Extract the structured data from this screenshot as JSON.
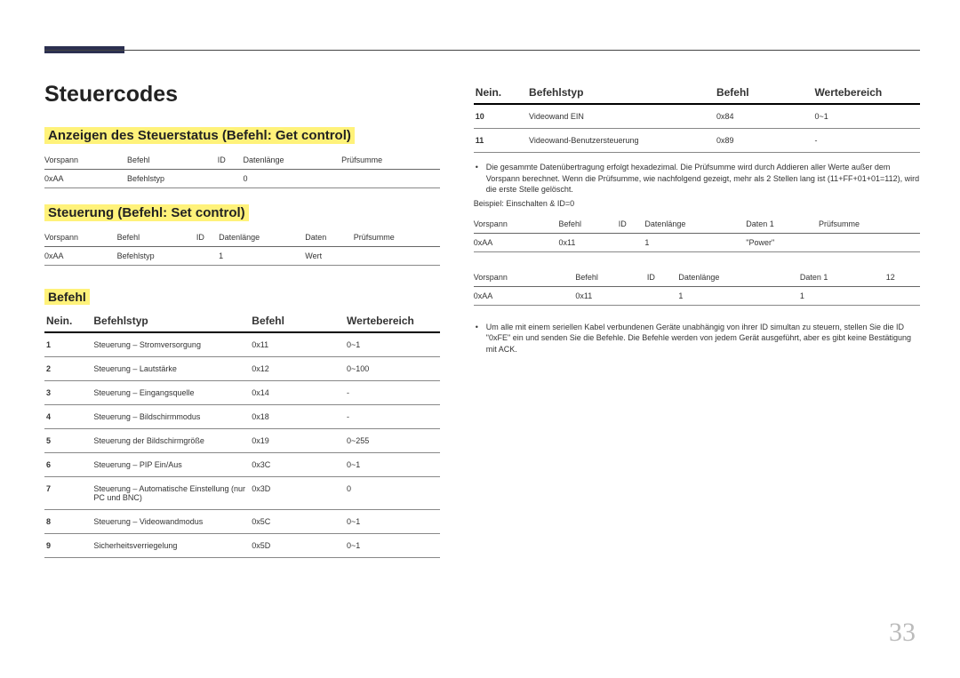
{
  "page_number": "33",
  "title": "Steuercodes",
  "section1": {
    "heading": "Anzeigen des Steuerstatus (Befehl: Get control)",
    "headers": [
      "Vorspann",
      "Befehl",
      "ID",
      "Datenlänge",
      "Prüfsumme"
    ],
    "row": [
      "0xAA",
      "Befehlstyp",
      "",
      "0",
      ""
    ]
  },
  "section2": {
    "heading": "Steuerung (Befehl: Set control)",
    "headers": [
      "Vorspann",
      "Befehl",
      "ID",
      "Datenlänge",
      "Daten",
      "Prüfsumme"
    ],
    "row": [
      "0xAA",
      "Befehlstyp",
      "",
      "1",
      "Wert",
      ""
    ]
  },
  "befehl_heading": "Befehl",
  "cmd_headers": {
    "no": "Nein.",
    "type": "Befehlstyp",
    "cmd": "Befehl",
    "range": "Wertebereich"
  },
  "cmd_rows_left": [
    {
      "no": "1",
      "type": "Steuerung – Stromversorgung",
      "cmd": "0x11",
      "range": "0~1"
    },
    {
      "no": "2",
      "type": "Steuerung – Lautstärke",
      "cmd": "0x12",
      "range": "0~100"
    },
    {
      "no": "3",
      "type": "Steuerung – Eingangsquelle",
      "cmd": "0x14",
      "range": "-"
    },
    {
      "no": "4",
      "type": "Steuerung – Bildschirmmodus",
      "cmd": "0x18",
      "range": "-"
    },
    {
      "no": "5",
      "type": "Steuerung der Bildschirmgröße",
      "cmd": "0x19",
      "range": "0~255"
    },
    {
      "no": "6",
      "type": "Steuerung – PIP Ein/Aus",
      "cmd": "0x3C",
      "range": "0~1"
    },
    {
      "no": "7",
      "type": "Steuerung – Automatische Einstellung (nur PC und BNC)",
      "cmd": "0x3D",
      "range": "0"
    },
    {
      "no": "8",
      "type": "Steuerung – Videowandmodus",
      "cmd": "0x5C",
      "range": "0~1"
    },
    {
      "no": "9",
      "type": "Sicherheitsverriegelung",
      "cmd": "0x5D",
      "range": "0~1"
    }
  ],
  "cmd_rows_right": [
    {
      "no": "10",
      "type": "Videowand EIN",
      "cmd": "0x84",
      "range": "0~1"
    },
    {
      "no": "11",
      "type": "Videowand-Benutzersteuerung",
      "cmd": "0x89",
      "range": "-"
    }
  ],
  "note1": "Die gesammte Datenübertragung erfolgt hexadezimal. Die Prüfsumme wird durch Addieren aller Werte außer dem Vorspann berechnet. Wenn die Prüfsumme, wie nachfolgend gezeigt, mehr als 2 Stellen lang ist (11+FF+01+01=112), wird die erste Stelle gelöscht.",
  "example_label": "Beispiel: Einschalten & ID=0",
  "example_table1": {
    "headers": [
      "Vorspann",
      "Befehl",
      "ID",
      "Datenlänge",
      "Daten 1",
      "Prüfsumme"
    ],
    "row": [
      "0xAA",
      "0x11",
      "",
      "1",
      "\"Power\"",
      ""
    ]
  },
  "example_table2": {
    "headers": [
      "Vorspann",
      "Befehl",
      "ID",
      "Datenlänge",
      "Daten 1",
      "12"
    ],
    "row": [
      "0xAA",
      "0x11",
      "",
      "1",
      "1",
      ""
    ]
  },
  "note2": "Um alle mit einem seriellen Kabel verbundenen Geräte unabhängig von ihrer ID simultan zu steuern, stellen Sie die ID \"0xFE\" ein und senden Sie die Befehle. Die Befehle werden von jedem Gerät ausgeführt, aber es gibt keine Bestätigung mit ACK."
}
